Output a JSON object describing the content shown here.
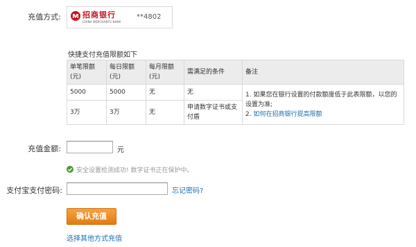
{
  "recharge_method": {
    "label": "充值方式:",
    "bank_logo_cn": "招商银行",
    "bank_logo_en": "CHINA MERCHANTS BANK",
    "card_number": "**4802"
  },
  "limits": {
    "title": "快捷支付充值限额如下",
    "headers": [
      "单笔限额(元)",
      "每日限额(元)",
      "每月限额(元)",
      "需满足的条件",
      "备注"
    ],
    "rows": [
      [
        "5000",
        "5000",
        "无",
        "无"
      ],
      [
        "3万",
        "3万",
        "无",
        "申请数字证书或支付盾"
      ]
    ],
    "note_line1": "1. 如果您在银行设置的付款额度低于此表限额，以您的设置为准;",
    "note_line2_prefix": "2. ",
    "note_line2_link": "如何在招商银行提高限额"
  },
  "amount": {
    "label": "充值金额:",
    "value": "",
    "unit": "元"
  },
  "security": {
    "message": "安全设置检测成功! 数字证书正在保护中。"
  },
  "password": {
    "label": "支付宝支付密码:",
    "value": "",
    "forgot_link": "忘记密码?"
  },
  "actions": {
    "confirm_label": "确认充值",
    "other_method_link": "选择其他方式充值"
  },
  "colors": {
    "link_blue": "#1a6fb0",
    "button_orange": "#e8861e",
    "bank_red": "#c7161e",
    "success_green": "#4a9a2f"
  }
}
